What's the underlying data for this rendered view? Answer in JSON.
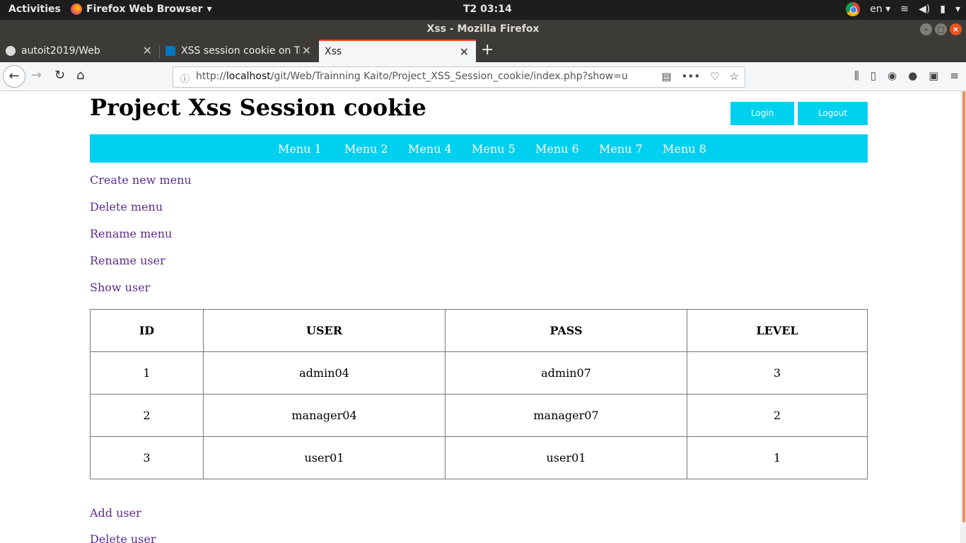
{
  "topbar": {
    "activities": "Activities",
    "app_name": "Firefox Web Browser",
    "clock": "T2 03:14",
    "language": "en"
  },
  "window": {
    "title": "Xss - Mozilla Firefox"
  },
  "tabs": [
    {
      "title": "autoit2019/Web",
      "icon": "github-icon"
    },
    {
      "title": "XSS session cookie on Tr",
      "icon": "trello-icon"
    },
    {
      "title": "Xss",
      "icon": "none",
      "active": true
    }
  ],
  "urlbar": {
    "prefix": "http://",
    "host": "localhost",
    "path": "/git/Web/Trainning Kaito/Project_XSS_Session_cookie/index.php?show=u"
  },
  "site": {
    "title": "Project Xss Session cookie",
    "login_label": "Login",
    "logout_label": "Logout",
    "accent_color": "#00d0f0",
    "link_color": "#5b2d8e"
  },
  "menu": [
    "Menu 1",
    "Menu 2",
    "Menu 4",
    "Menu 5",
    "Menu 6",
    "Menu 7",
    "Menu 8"
  ],
  "links": {
    "create_menu": "Create new menu",
    "delete_menu": "Delete menu",
    "rename_menu": "Rename menu",
    "rename_user": "Rename user",
    "show_user": "Show user",
    "add_user": "Add user",
    "delete_user": "Delete user"
  },
  "table": {
    "headers": [
      "ID",
      "USER",
      "PASS",
      "LEVEL"
    ],
    "rows": [
      [
        "1",
        "admin04",
        "admin07",
        "3"
      ],
      [
        "2",
        "manager04",
        "manager07",
        "2"
      ],
      [
        "3",
        "user01",
        "user01",
        "1"
      ]
    ]
  }
}
